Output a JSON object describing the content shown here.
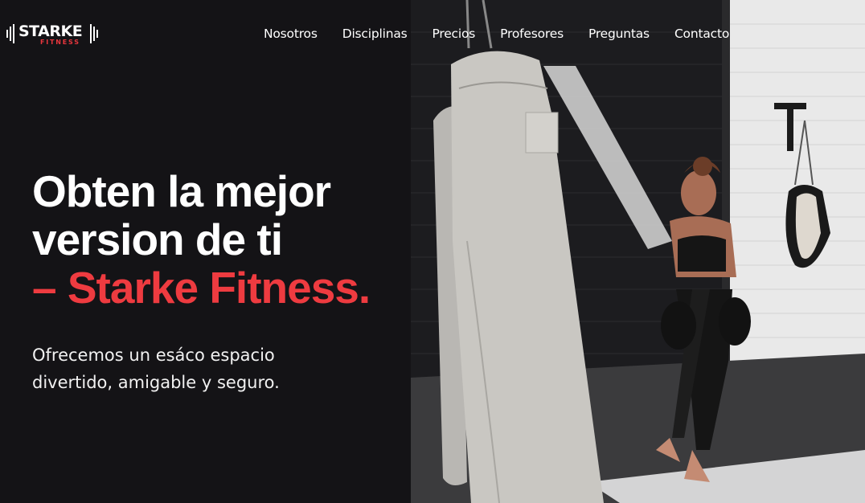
{
  "brand": {
    "name": "STARKE",
    "tagline": "FITNESS",
    "accent_color": "#ee3b40"
  },
  "nav": {
    "items": [
      {
        "label": "Nosotros"
      },
      {
        "label": "Disciplinas"
      },
      {
        "label": "Precios"
      },
      {
        "label": "Profesores"
      },
      {
        "label": "Preguntas"
      },
      {
        "label": "Contacto"
      }
    ]
  },
  "hero": {
    "title_line1": "Obten la mejor",
    "title_line2": "version de ti",
    "title_line3": "– Starke Fitness.",
    "subtitle_line1": "Ofrecemos un esáco espacio",
    "subtitle_line2": "divertido, amigable y seguro."
  },
  "photo": {
    "icon": "boxing-gym-photo"
  }
}
